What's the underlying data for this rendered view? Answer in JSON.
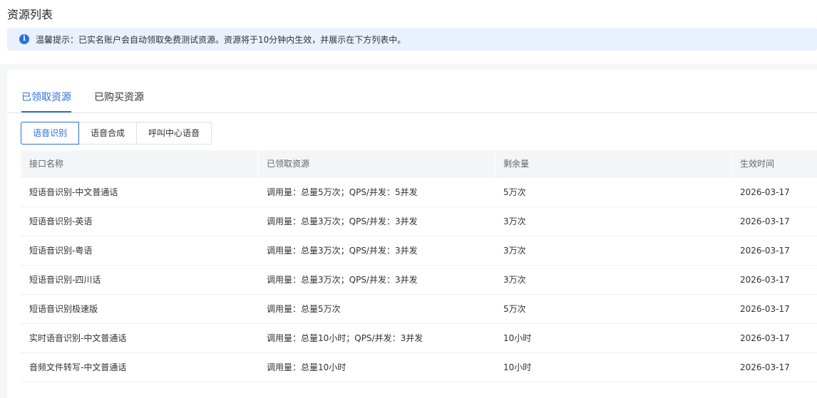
{
  "page": {
    "title": "资源列表",
    "notice": "温馨提示：已实名账户会自动领取免费测试资源。资源将于10分钟内生效，并展示在下方列表中。"
  },
  "tabs": [
    {
      "label": "已领取资源",
      "active": true
    },
    {
      "label": "已购买资源",
      "active": false
    }
  ],
  "segments": [
    {
      "label": "语音识别",
      "active": true
    },
    {
      "label": "语音合成",
      "active": false
    },
    {
      "label": "呼叫中心语音",
      "active": false
    }
  ],
  "table": {
    "headers": [
      "接口名称",
      "已领取资源",
      "剩余量",
      "生效时间"
    ],
    "rows": [
      [
        "短语音识别-中文普通话",
        "调用量：总量5万次；QPS/并发：5并发",
        "5万次",
        "2026-03-17"
      ],
      [
        "短语音识别-英语",
        "调用量：总量3万次；QPS/并发：3并发",
        "3万次",
        "2026-03-17"
      ],
      [
        "短语音识别-粤语",
        "调用量：总量3万次；QPS/并发：3并发",
        "3万次",
        "2026-03-17"
      ],
      [
        "短语音识别-四川话",
        "调用量：总量3万次；QPS/并发：3并发",
        "3万次",
        "2026-03-17"
      ],
      [
        "短语音识别极速版",
        "调用量：总量5万次",
        "5万次",
        "2026-03-17"
      ],
      [
        "实时语音识别-中文普通话",
        "调用量：总量10小时；QPS/并发：3并发",
        "10小时",
        "2026-03-17"
      ],
      [
        "音频文件转写-中文普通话",
        "调用量：总量10小时",
        "10小时",
        "2026-03-17"
      ]
    ]
  },
  "colors": {
    "accent": "#2c6fe0",
    "notice_bg": "#e9f1fc",
    "header_bg": "#f4f5f7"
  },
  "icons": {
    "notice_icon": "info-icon"
  }
}
